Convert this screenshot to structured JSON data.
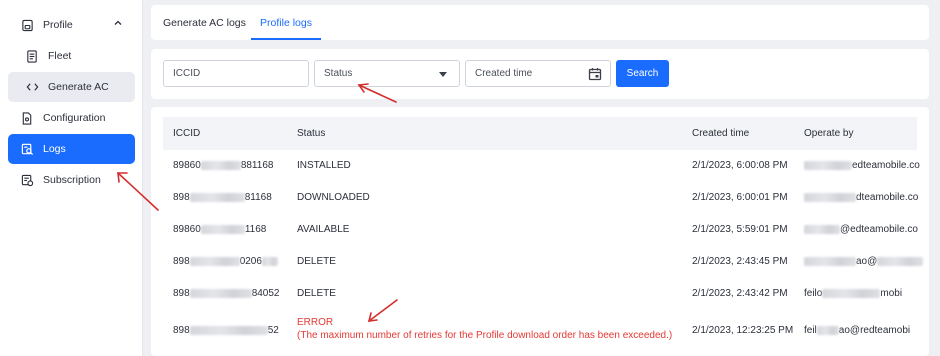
{
  "sidebar": {
    "items": [
      {
        "label": "Profile",
        "icon": "profile-icon",
        "state": "expanded"
      },
      {
        "label": "Fleet",
        "icon": "document-icon"
      },
      {
        "label": "Generate AC",
        "icon": "code-icon",
        "state": "selected"
      },
      {
        "label": "Configuration",
        "icon": "config-file-icon"
      },
      {
        "label": "Logs",
        "icon": "logs-search-icon",
        "state": "active"
      },
      {
        "label": "Subscription",
        "icon": "subscription-icon"
      }
    ]
  },
  "tabs": [
    {
      "label": "Generate AC logs",
      "active": false
    },
    {
      "label": "Profile logs",
      "active": true
    }
  ],
  "filters": {
    "iccid_placeholder": "ICCID",
    "status_value": "Status",
    "created_time_placeholder": "Created time",
    "search_label": "Search"
  },
  "table": {
    "headers": [
      "ICCID",
      "Status",
      "Created time",
      "Operate by"
    ],
    "rows": [
      {
        "iccid_prefix": "89860",
        "iccid_suffix": "881168",
        "status": "INSTALLED",
        "time": "2/1/2023, 6:00:08 PM",
        "op_prefix": "",
        "op_suffix": "edteamobile.co"
      },
      {
        "iccid_prefix": "898",
        "iccid_suffix": "81168",
        "status": "DOWNLOADED",
        "time": "2/1/2023, 6:00:01 PM",
        "op_prefix": "",
        "op_suffix": "dteamobile.co"
      },
      {
        "iccid_prefix": "89860",
        "iccid_suffix": "1168",
        "status": "AVAILABLE",
        "time": "2/1/2023, 5:59:01 PM",
        "op_prefix": "",
        "op_suffix": "@edteamobile.co"
      },
      {
        "iccid_prefix": "898",
        "iccid_suffix": "0206",
        "status": "DELETE",
        "time": "2/1/2023, 2:43:45 PM",
        "op_prefix": "",
        "op_suffix": "ao@"
      },
      {
        "iccid_prefix": "898",
        "iccid_suffix": "84052",
        "status": "DELETE",
        "time": "2/1/2023, 2:43:42 PM",
        "op_prefix": "feilo",
        "op_suffix": "mobi"
      },
      {
        "iccid_prefix": "898",
        "iccid_suffix": "52",
        "status": "ERROR",
        "status_detail": "(The maximum number of retries for the Profile download order has been exceeded.)",
        "time": "2/1/2023, 12:23:25 PM",
        "op_prefix": "feil",
        "op_suffix": "ao@redteamobi"
      }
    ]
  },
  "colors": {
    "accent": "#1a6cff",
    "error": "#e53935",
    "annotation": "#d32f2f"
  }
}
